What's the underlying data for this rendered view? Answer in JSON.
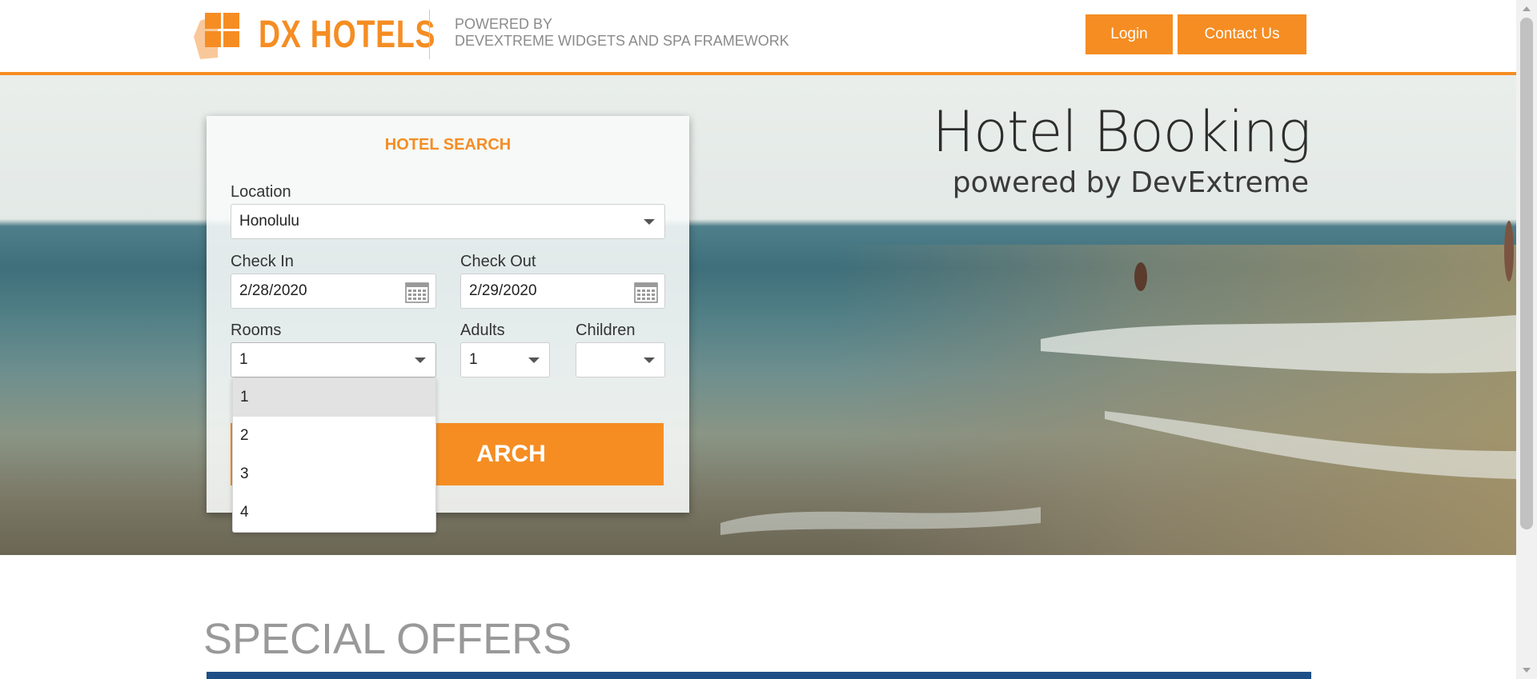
{
  "header": {
    "logo_text": "DX HOTELS",
    "powered_line1": "POWERED BY",
    "powered_line2": "DEVEXTREME WIDGETS AND SPA FRAMEWORK",
    "login_label": "Login",
    "contact_label": "Contact Us",
    "accent_color": "#f58d23"
  },
  "hero": {
    "title": "Hotel Booking",
    "subtitle": "powered by DevExtreme"
  },
  "search": {
    "title": "HOTEL SEARCH",
    "location_label": "Location",
    "location_value": "Honolulu",
    "checkin_label": "Check In",
    "checkin_value": "2/28/2020",
    "checkout_label": "Check Out",
    "checkout_value": "2/29/2020",
    "rooms_label": "Rooms",
    "rooms_value": "1",
    "adults_label": "Adults",
    "adults_value": "1",
    "children_label": "Children",
    "children_value": "",
    "search_button_visible_text": "ARCH",
    "rooms_options": [
      "1",
      "2",
      "3",
      "4"
    ],
    "rooms_selected_option": "1"
  },
  "offers": {
    "title": "SPECIAL OFFERS"
  },
  "icons": [
    "logo-icon",
    "calendar-icon",
    "chevron-down-icon"
  ]
}
